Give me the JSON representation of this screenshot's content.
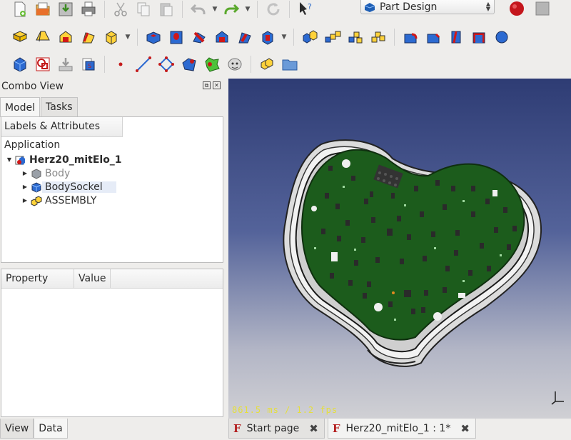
{
  "toolbar1": {
    "icons": [
      "new-file-icon",
      "open-file-icon",
      "save-icon",
      "print-icon",
      "cut-icon",
      "copy-icon",
      "paste-icon",
      "undo-icon",
      "redo-icon",
      "refresh-icon",
      "whats-this-icon",
      "record-macro-icon",
      "stop-macro-icon"
    ],
    "workbench": "Part Design"
  },
  "toolbar2": {
    "icons": [
      "pad-icon",
      "revolution-icon",
      "additive-loft-icon",
      "additive-pipe-icon",
      "additive-box-icon",
      "pocket-icon",
      "hole-icon",
      "groove-icon",
      "subtractive-loft-icon",
      "subtractive-pipe-icon",
      "subtractive-box-icon",
      "mirrored-icon",
      "linear-pattern-icon",
      "polar-pattern-icon",
      "multi-transform-icon",
      "fillet-icon",
      "chamfer-icon",
      "draft-icon",
      "thickness-icon",
      "boolean-icon"
    ]
  },
  "toolbar3": {
    "icons": [
      "body-icon",
      "sketch-icon",
      "import-icon",
      "shape-binder-icon",
      "datum-point-icon",
      "datum-line-icon",
      "datum-plane-icon",
      "local-cs-icon",
      "sub-shape-binder-icon",
      "clone-icon",
      "part-icon",
      "group-icon"
    ]
  },
  "combo_view": {
    "title": "Combo View",
    "tabs": [
      "Model",
      "Tasks"
    ],
    "tree_header": "Labels & Attributes",
    "section": "Application",
    "root": "Herz20_mitElo_1",
    "items": [
      {
        "label": "Body",
        "state": "hidden"
      },
      {
        "label": "BodySockel",
        "state": "selected"
      },
      {
        "label": "ASSEMBLY",
        "state": "normal"
      }
    ],
    "property_headers": [
      "Property",
      "Value"
    ],
    "bottom_tabs": [
      "View",
      "Data"
    ]
  },
  "view3d": {
    "fps_text": "861.5 ms / 1.2 fps",
    "colors": {
      "board": "#1c5c1c",
      "board_edge": "#0f2f0f",
      "case": "#d8d8d8",
      "background_top": "#2e3c74",
      "background_bottom": "#d0d0d4"
    }
  },
  "document_tabs": [
    {
      "label": "Start page",
      "active": false
    },
    {
      "label": "Herz20_mitElo_1 : 1*",
      "active": true
    }
  ]
}
